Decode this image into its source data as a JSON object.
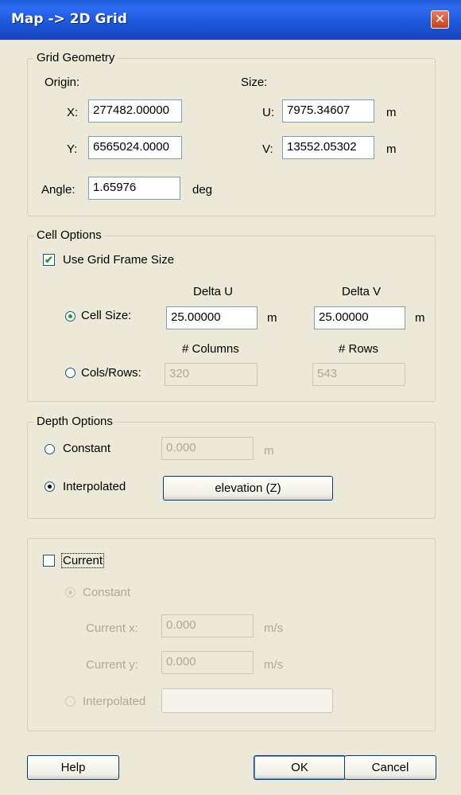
{
  "window": {
    "title": "Map -> 2D Grid",
    "close_glyph": "✕"
  },
  "grid_geometry": {
    "legend": "Grid Geometry",
    "origin_label": "Origin:",
    "size_label": "Size:",
    "x_label": "X:",
    "x_value": "277482.00000",
    "y_label": "Y:",
    "y_value": "6565024.0000",
    "u_label": "U:",
    "u_value": "7975.34607",
    "u_unit": "m",
    "v_label": "V:",
    "v_value": "13552.05302",
    "v_unit": "m",
    "angle_label": "Angle:",
    "angle_value": "1.65976",
    "angle_unit": "deg"
  },
  "cell_options": {
    "legend": "Cell Options",
    "use_frame_label": "Use Grid Frame Size",
    "use_frame_checked": true,
    "delta_u_header": "Delta U",
    "delta_v_header": "Delta V",
    "cell_size_label": "Cell Size:",
    "cell_size_u": "25.00000",
    "cell_size_u_unit": "m",
    "cell_size_v": "25.00000",
    "cell_size_v_unit": "m",
    "columns_header": "# Columns",
    "rows_header": "# Rows",
    "colsrows_label": "Cols/Rows:",
    "columns_value": "320",
    "rows_value": "543",
    "selected": "cell_size"
  },
  "depth_options": {
    "legend": "Depth Options",
    "constant_label": "Constant",
    "constant_value": "0.000",
    "constant_unit": "m",
    "interpolated_label": "Interpolated",
    "interpolated_button": "elevation (Z)",
    "selected": "interpolated"
  },
  "current": {
    "checkbox_label": "Current",
    "checked": false,
    "constant_label": "Constant",
    "current_x_label": "Current x:",
    "current_x_value": "0.000",
    "current_x_unit": "m/s",
    "current_y_label": "Current y:",
    "current_y_value": "0.000",
    "current_y_unit": "m/s",
    "interpolated_label": "Interpolated",
    "interpolated_button": ""
  },
  "footer": {
    "help": "Help",
    "ok": "OK",
    "cancel": "Cancel"
  },
  "colors": {
    "titlebar": "#1f5bd6",
    "dialog_bg": "#ece9d8",
    "disabled_text": "#aca899",
    "radio_dot": "#21a121"
  }
}
